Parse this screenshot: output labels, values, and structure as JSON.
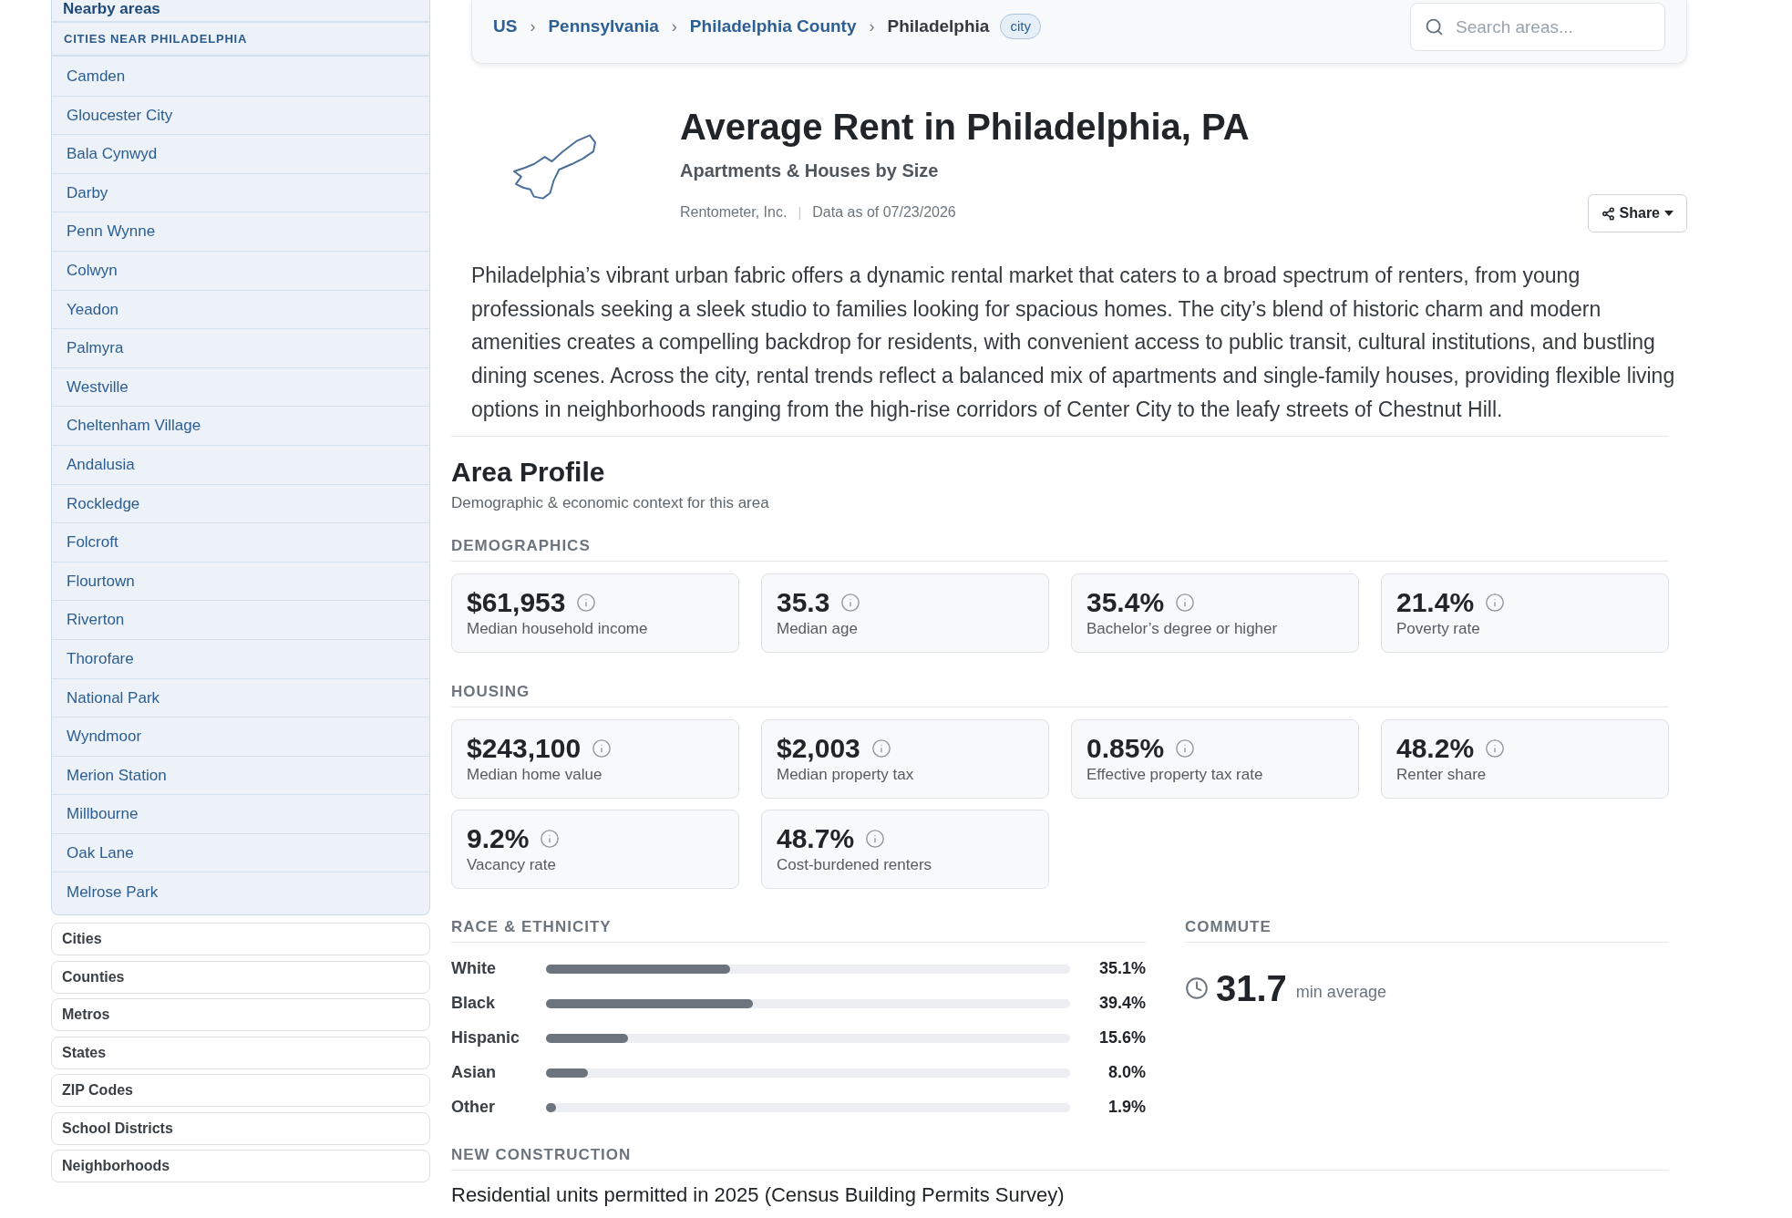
{
  "sidebar": {
    "header": "Nearby areas",
    "section_title": "CITIES NEAR PHILADELPHIA",
    "items": [
      "Camden",
      "Gloucester City",
      "Bala Cynwyd",
      "Darby",
      "Penn Wynne",
      "Colwyn",
      "Yeadon",
      "Palmyra",
      "Westville",
      "Cheltenham Village",
      "Andalusia",
      "Rockledge",
      "Folcroft",
      "Flourtown",
      "Riverton",
      "Thorofare",
      "National Park",
      "Wyndmoor",
      "Merion Station",
      "Millbourne",
      "Oak Lane",
      "Melrose Park"
    ],
    "nav_buttons": [
      "Cities",
      "Counties",
      "Metros",
      "States",
      "ZIP Codes",
      "School Districts",
      "Neighborhoods"
    ]
  },
  "breadcrumb": [
    {
      "kind": "link",
      "label": "US"
    },
    {
      "kind": "separator",
      "label": "›"
    },
    {
      "kind": "link",
      "label": "Pennsylvania"
    },
    {
      "kind": "separator",
      "label": "›"
    },
    {
      "kind": "link",
      "label": "Philadelphia County"
    },
    {
      "kind": "separator",
      "label": "›"
    },
    {
      "kind": "current",
      "label": "Philadelphia"
    },
    {
      "kind": "badge",
      "label": "city"
    }
  ],
  "search": {
    "placeholder": "Search areas..."
  },
  "header": {
    "title": "Average Rent in Philadelphia, PA",
    "subtitle": "Apartments & Houses by Size",
    "meta": [
      {
        "kind": "text",
        "label": "Rentometer, Inc."
      },
      {
        "kind": "separator",
        "label": "|"
      },
      {
        "kind": "text",
        "label": "Data as of 07/23/2026"
      }
    ],
    "share_button": "Share"
  },
  "description": "Philadelphia’s vibrant urban fabric offers a dynamic rental market that caters to a broad spectrum of renters, from young professionals seeking a sleek studio to families looking for spacious homes. The city’s blend of historic charm and modern amenities creates a compelling backdrop for residents, with convenient access to public transit, cultural institutions, and bustling dining scenes. Across the city, rental trends reflect a balanced mix of apartments and single-family houses, providing flexible living options in neighborhoods ranging from the high-rise corridors of Center City to the leafy streets of Chestnut Hill.",
  "area_profile": {
    "title": "Area Profile",
    "subtitle": "Demographic & economic context for this area",
    "sections": [
      {
        "heading": "DEMOGRAPHICS",
        "stats": [
          {
            "value": "$61,953",
            "label": "Median household income"
          },
          {
            "value": "35.3",
            "label": "Median age"
          },
          {
            "value": "35.4%",
            "label": "Bachelor’s degree or higher"
          },
          {
            "value": "21.4%",
            "label": "Poverty rate"
          }
        ]
      },
      {
        "heading": "HOUSING",
        "stats": [
          {
            "value": "$243,100",
            "label": "Median home value"
          },
          {
            "value": "$2,003",
            "label": "Median property tax"
          },
          {
            "value": "0.85%",
            "label": "Effective property tax rate"
          },
          {
            "value": "48.2%",
            "label": "Renter share"
          },
          {
            "value": "9.2%",
            "label": "Vacancy rate"
          },
          {
            "value": "48.7%",
            "label": "Cost-burdened renters"
          }
        ]
      }
    ],
    "race_ethnicity": {
      "heading": "RACE & ETHNICITY",
      "rows": [
        {
          "label": "White",
          "level": 0.351,
          "reading": "35.1%"
        },
        {
          "label": "Black",
          "level": 0.394,
          "reading": "39.4%"
        },
        {
          "label": "Hispanic",
          "level": 0.156,
          "reading": "15.6%"
        },
        {
          "label": "Asian",
          "level": 0.08,
          "reading": "8.0%"
        },
        {
          "label": "Other",
          "level": 0.019,
          "reading": "1.9%"
        }
      ]
    },
    "commute": {
      "heading": "COMMUTE",
      "value": "31.7",
      "unit": "min average"
    },
    "new_construction": {
      "heading": "NEW CONSTRUCTION",
      "caption": "Residential units permitted in 2025 (Census Building Permits Survey)"
    }
  }
}
